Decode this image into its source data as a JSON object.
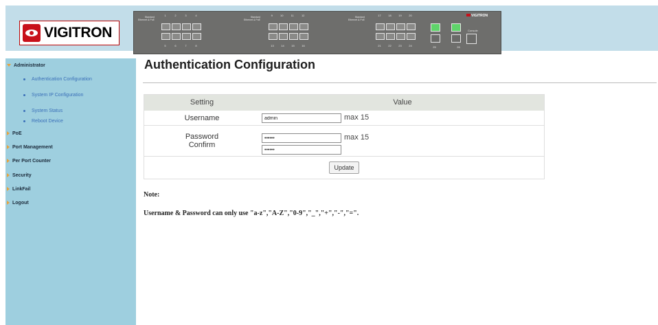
{
  "header": {
    "logo_text": "VIGITRON",
    "panel": {
      "group_labels": [
        "Standard Ethernet & PoE",
        "Standard Ethernet & PoE",
        "Standard Ethernet & PoE"
      ],
      "top_numbers": [
        [
          "1",
          "2",
          "3",
          "4"
        ],
        [
          "9",
          "10",
          "11",
          "12"
        ],
        [
          "17",
          "18",
          "19",
          "20"
        ]
      ],
      "bottom_numbers": [
        [
          "5",
          "6",
          "7",
          "8"
        ],
        [
          "13",
          "14",
          "15",
          "16"
        ],
        [
          "21",
          "22",
          "23",
          "24"
        ]
      ],
      "sfp_numbers": [
        "25",
        "26"
      ],
      "brand": "VIGITRON",
      "console_label": "Console"
    }
  },
  "sidebar": {
    "sections": [
      {
        "label": "Administrator",
        "expanded": true,
        "items": [
          {
            "label": "Authentication Configuration"
          },
          {
            "label": "System IP Configuration"
          },
          {
            "label": "System Status"
          },
          {
            "label": "Reboot Device"
          }
        ]
      },
      {
        "label": "PoE"
      },
      {
        "label": "Port Management"
      },
      {
        "label": "Per Port Counter"
      },
      {
        "label": "Security"
      },
      {
        "label": "LinkFail"
      },
      {
        "label": "Logout"
      }
    ]
  },
  "main": {
    "title": "Authentication Configuration",
    "table": {
      "col_setting": "Setting",
      "col_value": "Value",
      "username_label": "Username",
      "username_value": "admin",
      "username_hint": "max 15",
      "password_label": "Password",
      "confirm_label": "Confirm",
      "password_value": "••••••",
      "confirm_value": "••••••",
      "password_hint": "max 15",
      "update_button": "Update"
    },
    "note_label": "Note:",
    "note_text": "Username & Password can only use \"a-z\",\"A-Z\",\"0-9\",\"_\",\"+\",\"-\",\"=\"."
  },
  "colors": {
    "header_bg": "#c2dde9",
    "sidebar_bg": "#9ecfdf",
    "logo_red": "#c8101a",
    "sfp_green": "#5fd46a",
    "link_blue": "#3a6fb8"
  }
}
